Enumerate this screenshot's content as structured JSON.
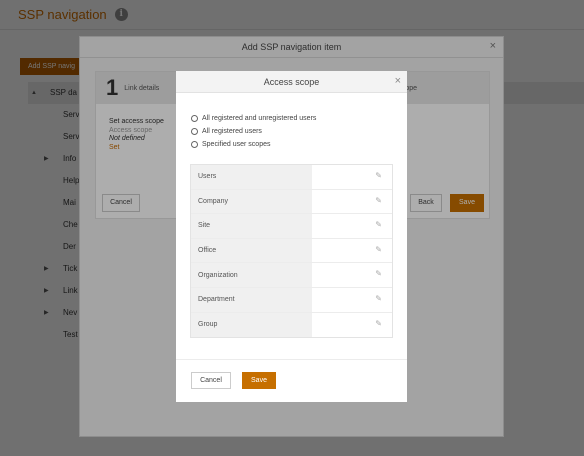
{
  "page": {
    "title": "SSP navigation",
    "info_icon": "info-icon",
    "add_button": "Add SSP navig",
    "tree": [
      {
        "label": "SSP da",
        "arrow": "▲",
        "level": "root"
      },
      {
        "label": "Serv",
        "arrow": "",
        "level": "child"
      },
      {
        "label": "Serv",
        "arrow": "",
        "level": "child"
      },
      {
        "label": "Info",
        "arrow": "▶",
        "level": "child"
      },
      {
        "label": "Help",
        "arrow": "",
        "level": "child"
      },
      {
        "label": "Mai",
        "arrow": "",
        "level": "child"
      },
      {
        "label": "Che",
        "arrow": "",
        "level": "child"
      },
      {
        "label": "Der",
        "arrow": "",
        "level": "child"
      },
      {
        "label": "Tick",
        "arrow": "▶",
        "level": "child"
      },
      {
        "label": "Link",
        "arrow": "▶",
        "level": "child"
      },
      {
        "label": "Nev",
        "arrow": "▶",
        "level": "child"
      },
      {
        "label": "Test",
        "arrow": "",
        "level": "child"
      }
    ]
  },
  "wizard_dialog": {
    "title": "Add SSP navigation item",
    "close": "×",
    "step_number": "1",
    "step_label": "Link details",
    "step_right": "scope",
    "set_access_scope": "Set access scope",
    "access_scope_label": "Access scope",
    "not_defined": "Not defined",
    "set_link": "Set",
    "cancel": "Cancel",
    "back": "Back",
    "save": "Save"
  },
  "access_modal": {
    "title": "Access scope",
    "close": "×",
    "radios": [
      "All registered and unregistered users",
      "All registered users",
      "Specified user scopes"
    ],
    "scopes": [
      "Users",
      "Company",
      "Site",
      "Office",
      "Organization",
      "Department",
      "Group"
    ],
    "edit_icon": "✎",
    "cancel": "Cancel",
    "save": "Save"
  },
  "colors": {
    "accent": "#c66f00",
    "title_orange": "#c76b00"
  }
}
